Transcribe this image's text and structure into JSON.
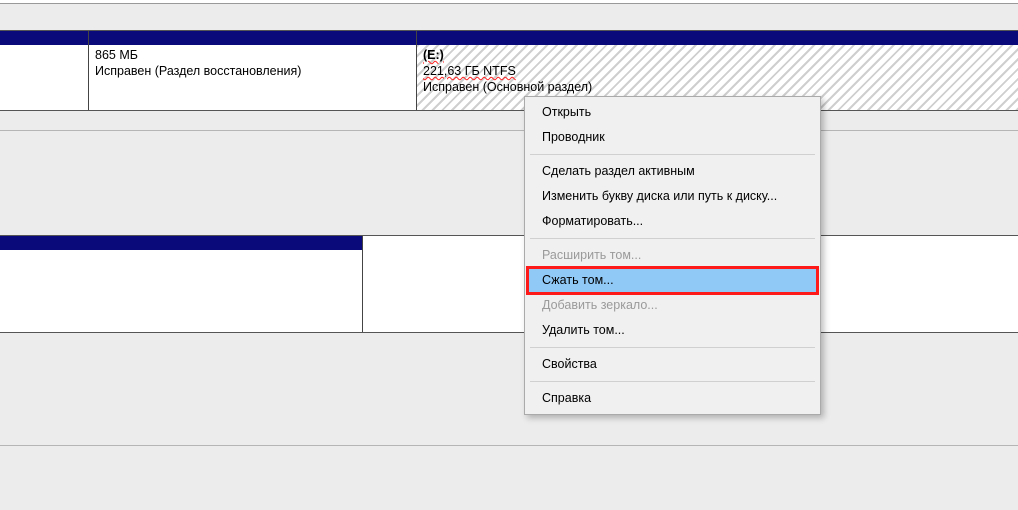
{
  "disk1": {
    "part_b": {
      "size": "865 МБ",
      "status": "Исправен (Раздел восстановления)"
    },
    "part_c": {
      "drive": "(E:)",
      "size": "221,63 ГБ NTFS",
      "status": "Исправен (Основной раздел)"
    }
  },
  "context_menu": {
    "open": "Открыть",
    "explorer": "Проводник",
    "make_active": "Сделать раздел активным",
    "change_letter": "Изменить букву диска или путь к диску...",
    "format": "Форматировать...",
    "extend": "Расширить том...",
    "shrink": "Сжать том...",
    "add_mirror": "Добавить зеркало...",
    "delete": "Удалить том...",
    "properties": "Свойства",
    "help": "Справка"
  }
}
